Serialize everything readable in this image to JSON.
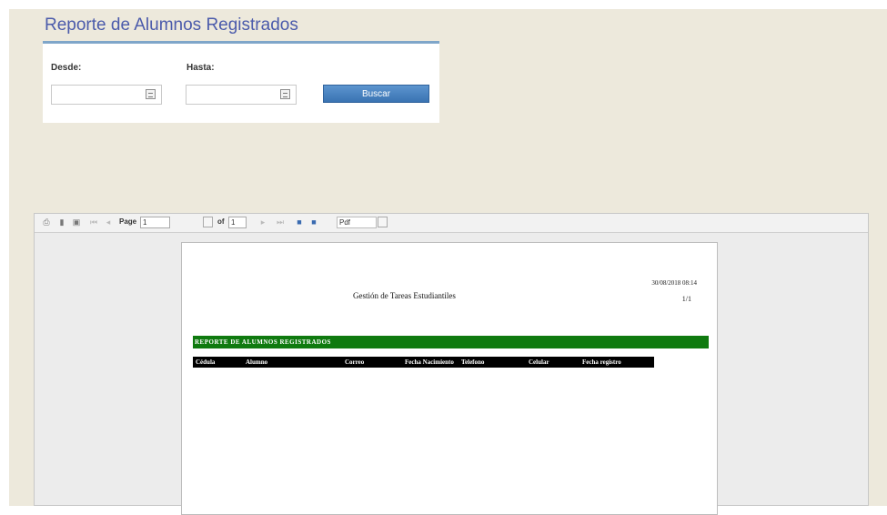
{
  "page": {
    "title": "Reporte de Alumnos Registrados"
  },
  "filters": {
    "desde_label": "Desde:",
    "hasta_label": "Hasta:",
    "desde_value": "",
    "hasta_value": "",
    "search_label": "Buscar"
  },
  "viewer": {
    "toolbar": {
      "page_label": "Page",
      "page_value": "1",
      "of_label": "of",
      "total_pages": "1",
      "format_value": "Pdf",
      "icons": [
        "print-icon",
        "export-icon",
        "print-setup-icon",
        "first-page-icon",
        "prev-page-icon",
        "next-page-icon",
        "last-page-icon",
        "save-icon",
        "save-as-icon",
        "format-dropdown-icon"
      ]
    },
    "report": {
      "datetime": "30/08/2018 08:14",
      "page_count": "1/1",
      "title": "Gestión de Tareas Estudiantiles",
      "banner": "REPORTE DE ALUMNOS REGISTRADOS",
      "columns": [
        "Cédula",
        "Alumno",
        "Correo",
        "Fecha Nacimiento",
        "Telefono",
        "Celular",
        "Fecha registro"
      ]
    }
  },
  "colors": {
    "background": "#ede9dc",
    "title": "#4b5bab",
    "button": "#3a73b2",
    "banner": "#0f7a0f",
    "header": "#000000"
  }
}
